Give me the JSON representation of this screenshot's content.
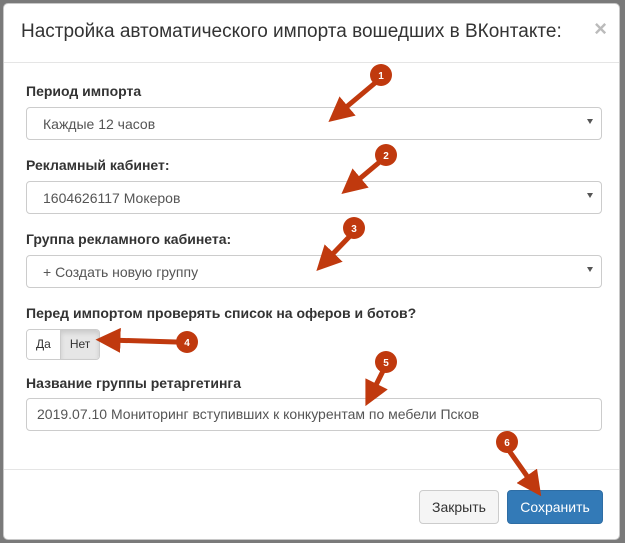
{
  "dialog": {
    "title": "Настройка автоматического импорта вошедших в ВКонтакте:",
    "close_symbol": "×"
  },
  "form": {
    "period": {
      "label": "Период импорта",
      "value": "Каждые 12 часов"
    },
    "ad_cabinet": {
      "label": "Рекламный кабинет:",
      "value": "1604626117 Мокеров"
    },
    "cabinet_group": {
      "label": "Группа рекламного кабинета:",
      "value": "+ Создать новую группу"
    },
    "check_bots": {
      "label": "Перед импортом проверять список на оферов и ботов?",
      "yes": "Да",
      "no": "Нет",
      "selected": "Нет"
    },
    "retargeting_group": {
      "label": "Название группы ретаргетинга",
      "value": "2019.07.10 Мониторинг вступивших к конкурентам по мебели Псков"
    }
  },
  "footer": {
    "close_label": "Закрыть",
    "save_label": "Сохранить"
  },
  "annotations": {
    "color": "#c0390e",
    "markers": [
      "1",
      "2",
      "3",
      "4",
      "5",
      "6"
    ]
  },
  "colors": {
    "primary": "#337ab7",
    "overlay": "#7a7a7a"
  }
}
